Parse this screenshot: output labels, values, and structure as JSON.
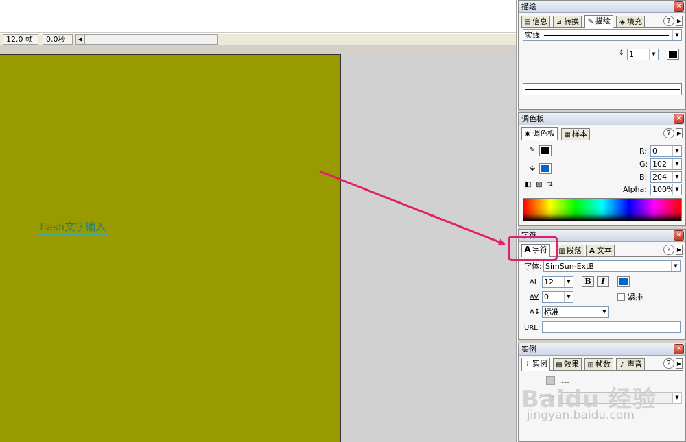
{
  "statusbar": {
    "fps": "12.0 帧",
    "time": "0.0秒"
  },
  "stage": {
    "text": "flash文字输入",
    "bg_color": "#999900"
  },
  "stroke_panel": {
    "title": "描绘",
    "tabs": [
      "信息",
      "转换",
      "描绘",
      "填充"
    ],
    "style_value": "实线",
    "width_value": "1"
  },
  "mixer_panel": {
    "title": "调色板",
    "tabs": [
      "调色板",
      "样本"
    ],
    "r_label": "R:",
    "r_value": "0",
    "g_label": "G:",
    "g_value": "102",
    "b_label": "B:",
    "b_value": "204",
    "alpha_label": "Alpha:",
    "alpha_value": "100%",
    "fill_color": "#0066cc"
  },
  "character_panel": {
    "title": "字符",
    "tabs": [
      "字符",
      "段落",
      "文本"
    ],
    "font_label": "字体:",
    "font_value": "SimSun-ExtB",
    "size_value": "12",
    "bold_label": "B",
    "italic_label": "I",
    "tracking_value": "0",
    "kern_label": "紧排",
    "baseline_value": "标准",
    "url_label": "URL:",
    "text_color": "#0066cc"
  },
  "instance_panel": {
    "title": "实例",
    "tabs": [
      "实例",
      "效果",
      "帧数",
      "声音"
    ],
    "item_text": "---",
    "behavior_label": "行为"
  },
  "watermark": {
    "logo": "Baidu 经验",
    "url": "jingyan.baidu.com"
  },
  "annotation": {
    "arrow_color": "#e0206a"
  }
}
